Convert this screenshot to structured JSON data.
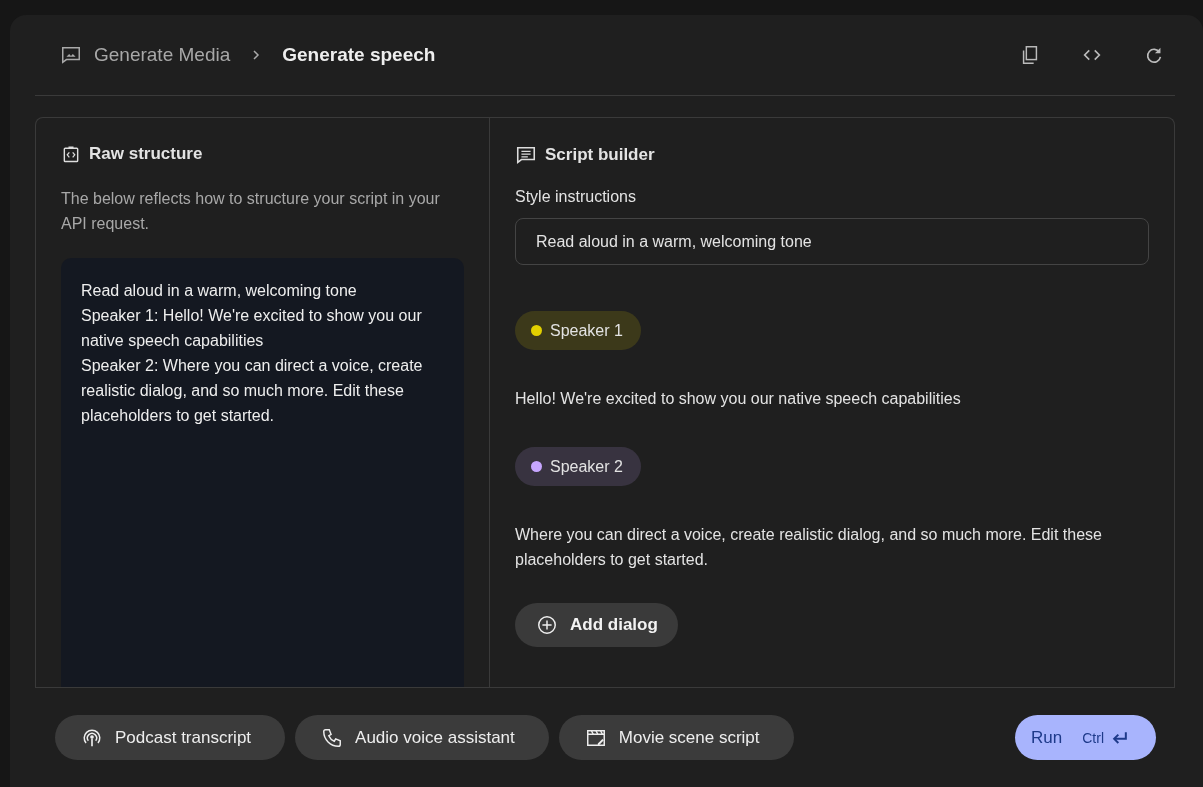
{
  "breadcrumb": {
    "parent": "Generate Media",
    "current": "Generate speech"
  },
  "raw_structure": {
    "title": "Raw structure",
    "description": "The below reflects how to structure your script in your API request.",
    "lines": [
      "Read aloud in a warm, welcoming tone",
      "Speaker 1: Hello! We're excited to show you our native speech capabilities",
      "Speaker 2: Where you can direct a voice, create realistic dialog, and so much more. Edit these placeholders to get started."
    ]
  },
  "script_builder": {
    "title": "Script builder",
    "style_label": "Style instructions",
    "style_value": "Read aloud in a warm, welcoming tone",
    "dialogs": [
      {
        "speaker": "Speaker 1",
        "color": "#e2d000",
        "text": "Hello! We're excited to show you our native speech capabilities"
      },
      {
        "speaker": "Speaker 2",
        "color": "#c7a6ff",
        "text": "Where you can direct a voice, create realistic dialog, and so much more. Edit these placeholders to get started."
      }
    ],
    "add_button": "Add dialog"
  },
  "presets": [
    {
      "kind": "podcast",
      "label": "Podcast transcript"
    },
    {
      "kind": "phone",
      "label": "Audio voice assistant"
    },
    {
      "kind": "movie",
      "label": "Movie scene script"
    }
  ],
  "run_button": {
    "label": "Run",
    "shortcut": "Ctrl"
  }
}
